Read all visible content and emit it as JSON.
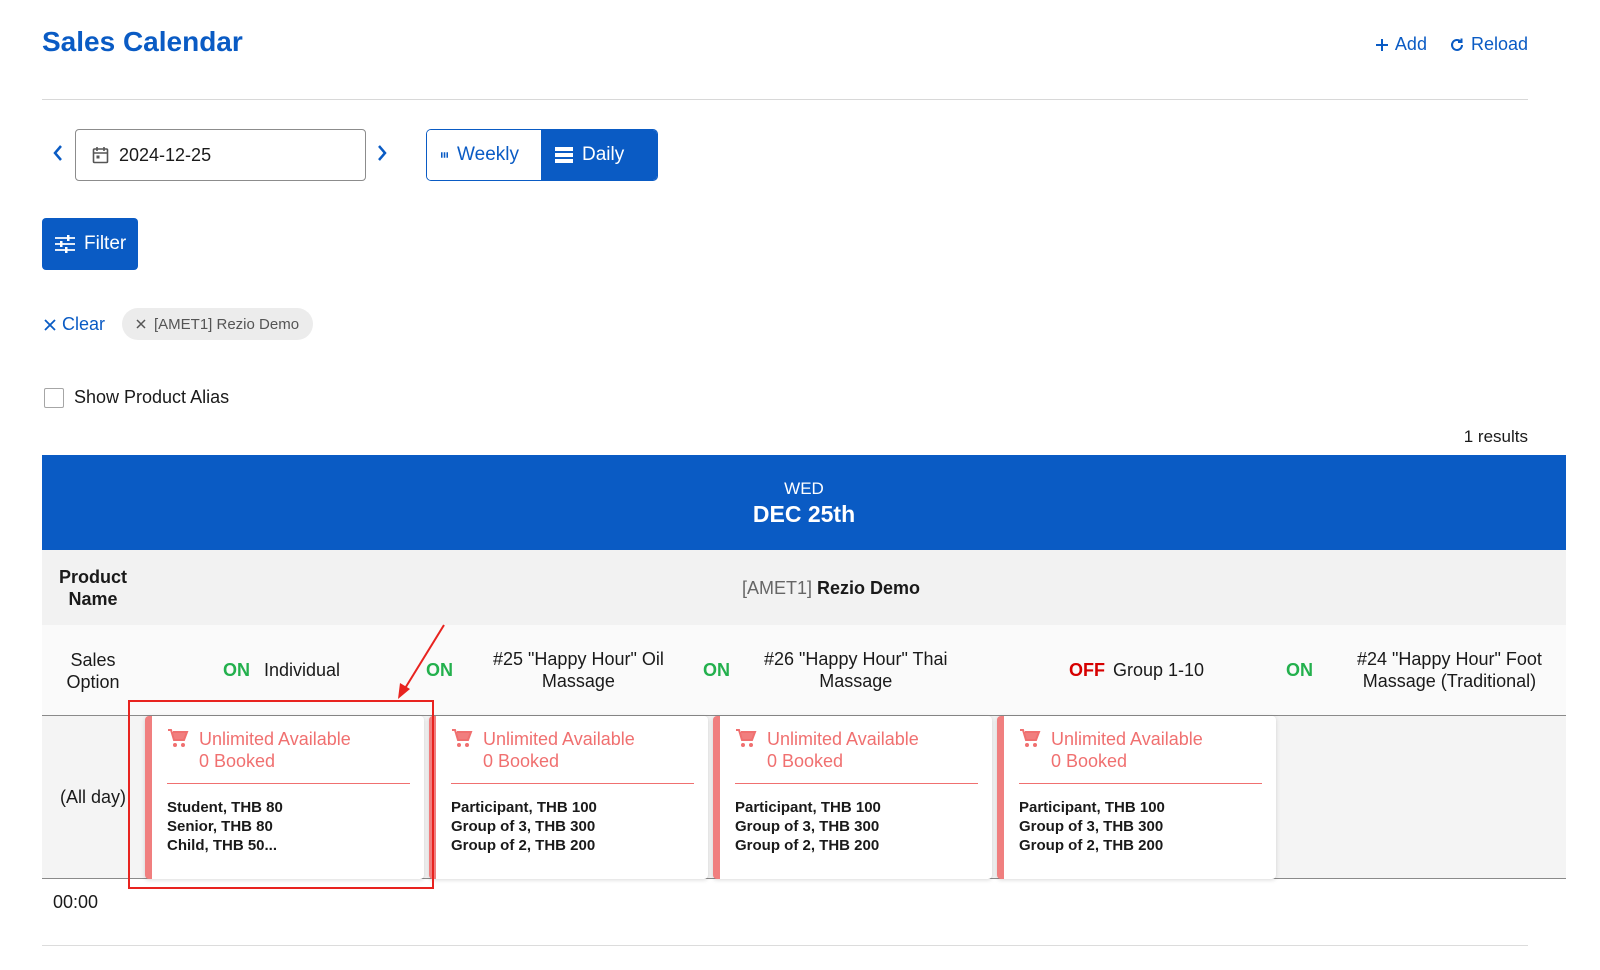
{
  "header": {
    "title": "Sales Calendar",
    "add_label": "Add",
    "reload_label": "Reload"
  },
  "date_nav": {
    "date_value": "2024-12-25"
  },
  "view_toggle": {
    "weekly_label": "Weekly",
    "daily_label": "Daily",
    "selected": "Daily"
  },
  "filter": {
    "button_label": "Filter",
    "clear_label": "Clear",
    "chip_label": "[AMET1] Rezio Demo"
  },
  "alias": {
    "label": "Show Product Alias",
    "checked": false
  },
  "results_text": "1 results",
  "calendar": {
    "day_of_week": "WED",
    "date_label": "DEC 25th",
    "product_name_label": "Product\nName",
    "product": {
      "code": "[AMET1]",
      "name": "Rezio Demo"
    },
    "sales_option_label": "Sales\nOption",
    "options": [
      {
        "status": "ON",
        "name": "Individual"
      },
      {
        "status": "ON",
        "name": "#25 \"Happy Hour\" Oil\nMassage"
      },
      {
        "status": "ON",
        "name": "#26 \"Happy Hour\" Thai\nMassage"
      },
      {
        "status": "OFF",
        "name": "Group 1-10"
      },
      {
        "status": "ON",
        "name": "#24 \"Happy Hour\" Foot\nMassage (Traditional)"
      }
    ],
    "all_day_label": "(All day)",
    "cards": [
      {
        "available": "Unlimited Available",
        "booked": "0 Booked",
        "prices": [
          "Student, THB 80",
          "Senior, THB 80",
          "Child, THB 50..."
        ]
      },
      {
        "available": "Unlimited Available",
        "booked": "0 Booked",
        "prices": [
          "Participant, THB 100",
          "Group of 3, THB 300",
          "Group of 2, THB 200"
        ]
      },
      {
        "available": "Unlimited Available",
        "booked": "0 Booked",
        "prices": [
          "Participant, THB 100",
          "Group of 3, THB 300",
          "Group of 2, THB 200"
        ]
      },
      {
        "available": "Unlimited Available",
        "booked": "0 Booked",
        "prices": [
          "Participant, THB 100",
          "Group of 3, THB 300",
          "Group of 2, THB 200"
        ]
      }
    ],
    "time_label": "00:00"
  },
  "colors": {
    "brand": "#0a5bc4",
    "on": "#23b04d",
    "off": "#d60000",
    "card_accent": "#f07f7f",
    "annotation": "#e8231f"
  },
  "icons": {
    "add": "plus-icon",
    "reload": "reload-icon",
    "prev": "chevron-left-icon",
    "next": "chevron-right-icon",
    "calendar": "calendar-icon",
    "weekly": "weekly-columns-icon",
    "daily": "daily-rows-icon",
    "filter": "filter-sliders-icon",
    "clear": "close-icon",
    "chip_remove": "close-icon",
    "cart": "cart-icon"
  }
}
